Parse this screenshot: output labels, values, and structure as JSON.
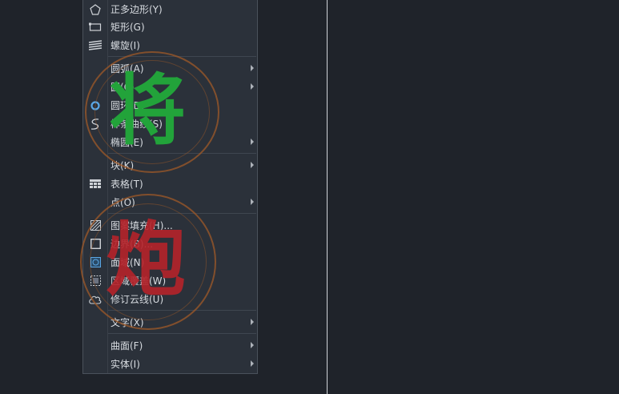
{
  "menu": {
    "items": [
      {
        "label": "正多边形(Y)",
        "icon": "polygon-icon",
        "submenu": false
      },
      {
        "label": "矩形(G)",
        "icon": "rectangle-icon",
        "submenu": false
      },
      {
        "label": "螺旋(I)",
        "icon": "helix-icon",
        "submenu": false
      },
      {
        "label": "圆弧(A)",
        "icon": "",
        "submenu": true
      },
      {
        "label": "圆(C)",
        "icon": "",
        "submenu": true
      },
      {
        "label": "圆环(D)",
        "icon": "donut-icon",
        "submenu": false
      },
      {
        "label": "样条曲线(S)",
        "icon": "spline-icon",
        "submenu": false
      },
      {
        "label": "椭圆(E)",
        "icon": "",
        "submenu": true
      },
      {
        "label": "块(K)",
        "icon": "",
        "submenu": true
      },
      {
        "label": "表格(T)",
        "icon": "table-icon",
        "submenu": false
      },
      {
        "label": "点(O)",
        "icon": "",
        "submenu": true
      },
      {
        "label": "图案填充(H)...",
        "icon": "hatch-icon",
        "submenu": false
      },
      {
        "label": "边界(B)...",
        "icon": "boundary-icon",
        "submenu": false
      },
      {
        "label": "面域(N)",
        "icon": "region-icon",
        "submenu": false
      },
      {
        "label": "区域覆盖(W)",
        "icon": "wipeout-icon",
        "submenu": false
      },
      {
        "label": "修订云线(U)",
        "icon": "revcloud-icon",
        "submenu": false
      },
      {
        "label": "文字(X)",
        "icon": "",
        "submenu": true
      },
      {
        "label": "曲面(F)",
        "icon": "",
        "submenu": true
      },
      {
        "label": "实体(I)",
        "icon": "",
        "submenu": true
      }
    ]
  },
  "watermarks": {
    "general": "将",
    "cannon": "炮"
  },
  "colors": {
    "canvas": "#1f232a",
    "menu_bg": "#2b313a",
    "text": "#d7dbe0",
    "general_green": "#22a33a",
    "cannon_red": "#b5232a",
    "stamp_brown": "#a05a28"
  }
}
